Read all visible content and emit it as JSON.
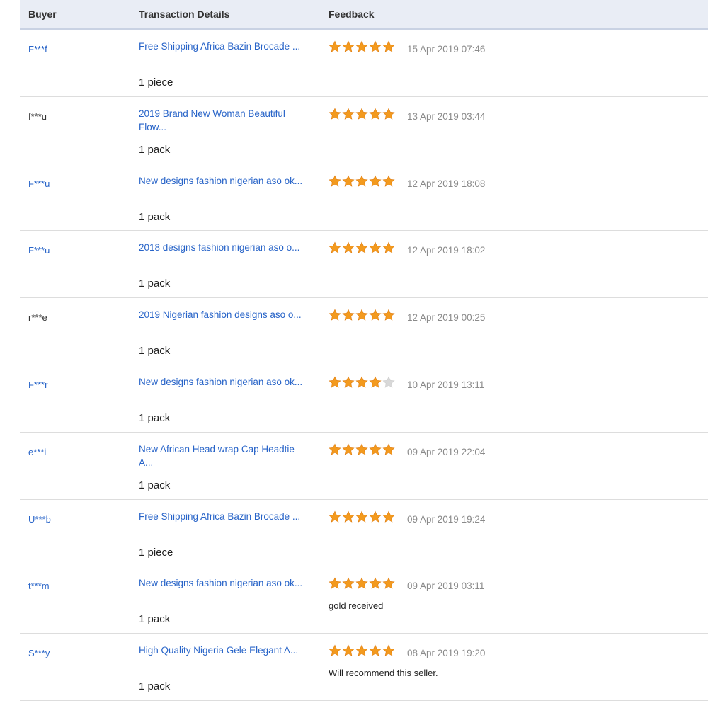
{
  "header": {
    "buyer": "Buyer",
    "details": "Transaction Details",
    "feedback": "Feedback"
  },
  "colors": {
    "link": "#2864c8",
    "star_on": "#f39a1e",
    "star_off": "#d8d8d8",
    "header_bg": "#e9edf5"
  },
  "rows": [
    {
      "buyer": "F***f",
      "buyer_is_link": true,
      "product": "Free Shipping Africa Bazin Brocade ...",
      "quantity": "1 piece",
      "rating": 5,
      "date": "15 Apr 2019 07:46",
      "comment": ""
    },
    {
      "buyer": "f***u",
      "buyer_is_link": false,
      "product": "2019 Brand New Woman Beautiful Flow...",
      "quantity": "1 pack",
      "rating": 5,
      "date": "13 Apr 2019 03:44",
      "comment": ""
    },
    {
      "buyer": "F***u",
      "buyer_is_link": true,
      "product": "New designs fashion nigerian aso ok...",
      "quantity": "1 pack",
      "rating": 5,
      "date": "12 Apr 2019 18:08",
      "comment": ""
    },
    {
      "buyer": "F***u",
      "buyer_is_link": true,
      "product": "2018 designs fashion nigerian aso o...",
      "quantity": "1 pack",
      "rating": 5,
      "date": "12 Apr 2019 18:02",
      "comment": ""
    },
    {
      "buyer": "r***e",
      "buyer_is_link": false,
      "product": "2019 Nigerian fashion designs aso o...",
      "quantity": "1 pack",
      "rating": 5,
      "date": "12 Apr 2019 00:25",
      "comment": ""
    },
    {
      "buyer": "F***r",
      "buyer_is_link": true,
      "product": "New designs fashion nigerian aso ok...",
      "quantity": "1 pack",
      "rating": 4,
      "date": "10 Apr 2019 13:11",
      "comment": ""
    },
    {
      "buyer": "e***i",
      "buyer_is_link": true,
      "product": "New African Head wrap Cap Headtie A...",
      "quantity": "1 pack",
      "rating": 5,
      "date": "09 Apr 2019 22:04",
      "comment": ""
    },
    {
      "buyer": "U***b",
      "buyer_is_link": true,
      "product": "Free Shipping Africa Bazin Brocade ...",
      "quantity": "1 piece",
      "rating": 5,
      "date": "09 Apr 2019 19:24",
      "comment": ""
    },
    {
      "buyer": "t***m",
      "buyer_is_link": true,
      "product": "New designs fashion nigerian aso ok...",
      "quantity": "1 pack",
      "rating": 5,
      "date": "09 Apr 2019 03:11",
      "comment": "gold received"
    },
    {
      "buyer": "S***y",
      "buyer_is_link": true,
      "product": "High Quality Nigeria Gele Elegant A...",
      "quantity": "1 pack",
      "rating": 5,
      "date": "08 Apr 2019 19:20",
      "comment": "Will recommend this seller."
    }
  ]
}
